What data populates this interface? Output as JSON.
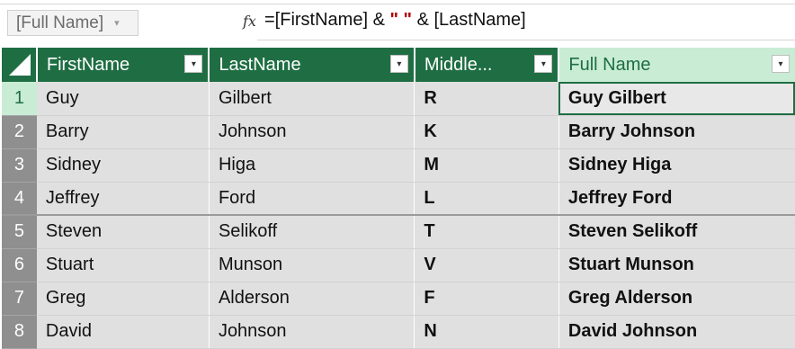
{
  "formula_bar": {
    "name_box": "[Full Name]",
    "name_box_arrow": "▾",
    "fx": "fx",
    "formula_pre": "=[FirstName] & ",
    "formula_quote": "\" \"",
    "formula_post": " & [LastName]"
  },
  "table": {
    "columns": [
      {
        "label": "FirstName"
      },
      {
        "label": "LastName"
      },
      {
        "label": "Middle..."
      },
      {
        "label": "Full Name"
      }
    ],
    "filter_glyph": "▾",
    "rows": [
      {
        "num": "1",
        "first": "Guy",
        "last": "Gilbert",
        "middle": "R",
        "full": "Guy Gilbert"
      },
      {
        "num": "2",
        "first": "Barry",
        "last": "Johnson",
        "middle": "K",
        "full": "Barry Johnson"
      },
      {
        "num": "3",
        "first": "Sidney",
        "last": "Higa",
        "middle": "M",
        "full": "Sidney Higa"
      },
      {
        "num": "4",
        "first": "Jeffrey",
        "last": "Ford",
        "middle": "L",
        "full": "Jeffrey Ford"
      },
      {
        "num": "5",
        "first": "Steven",
        "last": "Selikoff",
        "middle": "T",
        "full": "Steven Selikoff"
      },
      {
        "num": "6",
        "first": "Stuart",
        "last": "Munson",
        "middle": "V",
        "full": "Stuart Munson"
      },
      {
        "num": "7",
        "first": "Greg",
        "last": "Alderson",
        "middle": "F",
        "full": "Greg Alderson"
      },
      {
        "num": "8",
        "first": "David",
        "last": "Johnson",
        "middle": "N",
        "full": "David Johnson"
      }
    ]
  },
  "colors": {
    "header_green": "#1f6e43",
    "selected_header": "#c9ecd5",
    "cell_bg": "#e0e0e0",
    "row_number_bg": "#8f8f8f"
  }
}
